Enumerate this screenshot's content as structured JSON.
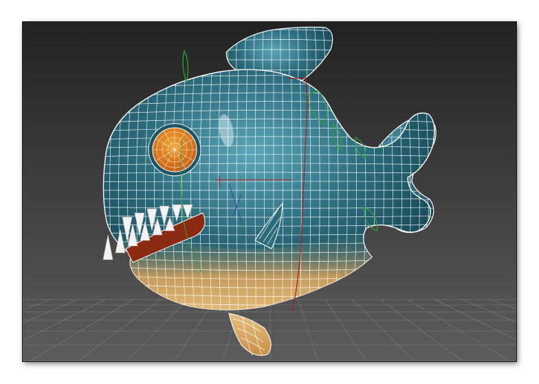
{
  "viewport": {
    "colors": {
      "background_top": "#222222",
      "background_bottom": "#5c5c5c",
      "grid_line": "#808080",
      "wire": "#ffffff",
      "body_dark": "#0f3a45",
      "body_mid": "#2b6b7c",
      "body_light": "#5aa6b8",
      "belly": "#d9a55e",
      "eye_outer": "#c45a10",
      "eye_inner": "#f0a030",
      "tooth": "#f2f2f2",
      "mouth": "#8a2a10"
    },
    "icons": {
      "model": "fish-mesh-icon",
      "grid": "perspective-grid-icon",
      "rig": "bone-rig-icon"
    }
  }
}
